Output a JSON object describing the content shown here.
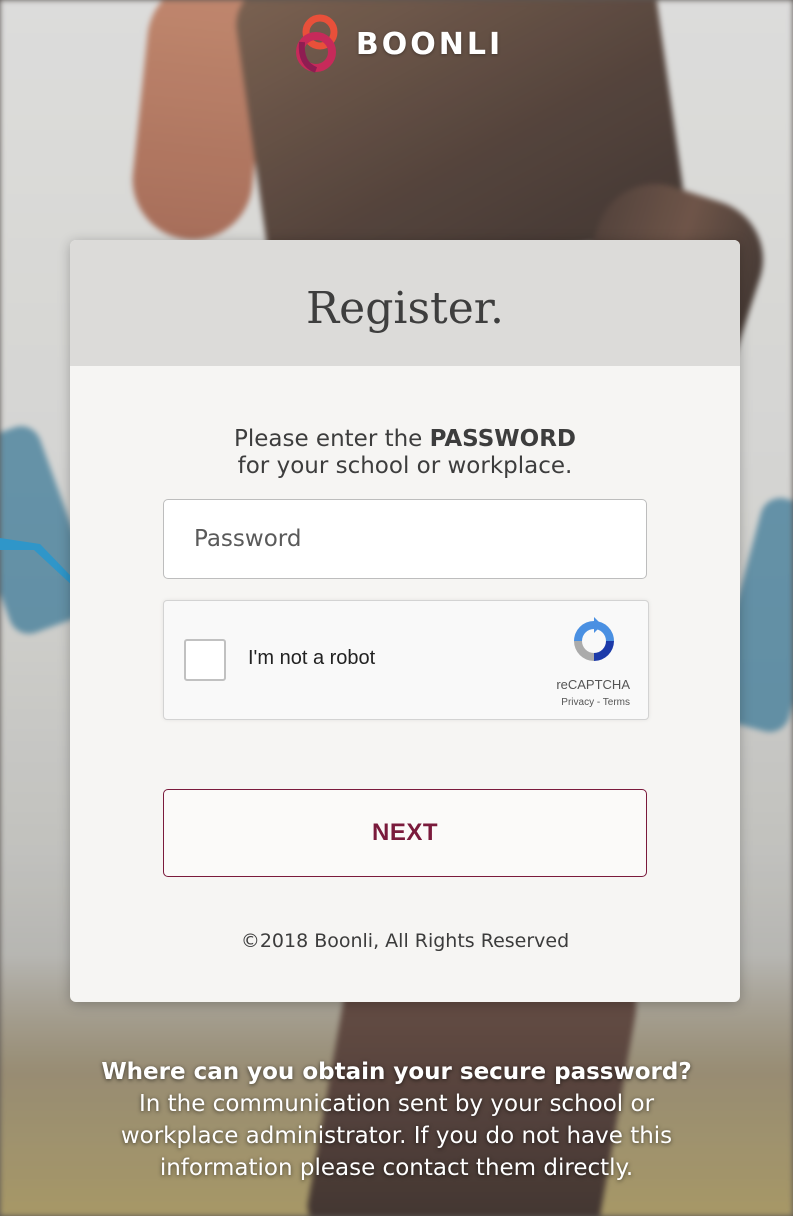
{
  "brand": {
    "name": "BOONLI",
    "logo_colors": [
      "#e8503a",
      "#c72a5a",
      "#8e1d52"
    ]
  },
  "card": {
    "title": "Register.",
    "instruction_pre": "Please enter the ",
    "instruction_bold": "PASSWORD",
    "instruction_post": "for your school or workplace.",
    "password_placeholder": "Password",
    "captcha": {
      "label": "I'm not a robot",
      "brand": "reCAPTCHA",
      "links": "Privacy - Terms"
    },
    "next_label": "NEXT",
    "copyright": "©2018 Boonli, All Rights Reserved"
  },
  "footer": {
    "question": "Where can you obtain your secure password?",
    "answer_line1": "In the communication sent by your school or",
    "answer_line2": "workplace administrator. If you do not have this",
    "answer_line3": "information please contact them directly."
  },
  "colors": {
    "accent": "#7a1a3c",
    "arrow": "#2f96c9",
    "card_bg": "#f6f5f3",
    "card_header_bg": "#dcdbd9"
  }
}
